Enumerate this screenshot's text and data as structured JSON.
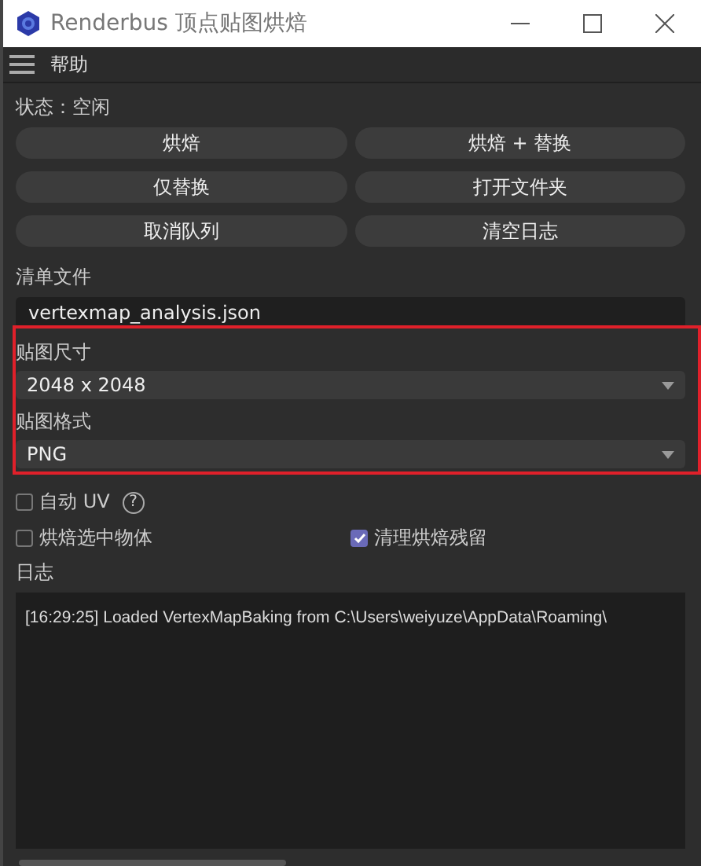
{
  "window": {
    "title": "Renderbus 顶点贴图烘焙"
  },
  "menu": {
    "items": [
      "帮助"
    ]
  },
  "status": "状态：空闲",
  "buttons": [
    "烘焙",
    "烘焙 + 替换",
    "仅替换",
    "打开文件夹",
    "取消队列",
    "清空日志"
  ],
  "manifest": {
    "label": "清单文件",
    "value": "vertexmap_analysis.json"
  },
  "dropdowns": [
    {
      "label": "贴图尺寸",
      "value": "2048 x 2048"
    },
    {
      "label": "贴图格式",
      "value": "PNG"
    }
  ],
  "options": [
    {
      "label": "自动 UV",
      "checked": false,
      "help": "?"
    },
    {
      "label": "烘焙选中物体",
      "checked": false
    },
    {
      "label": "清理烘焙残留",
      "checked": true
    }
  ],
  "log": {
    "label": "日志",
    "lines": [
      "[16:29:25] Loaded VertexMapBaking from C:\\Users\\weiyuze\\AppData\\Roaming\\"
    ]
  }
}
